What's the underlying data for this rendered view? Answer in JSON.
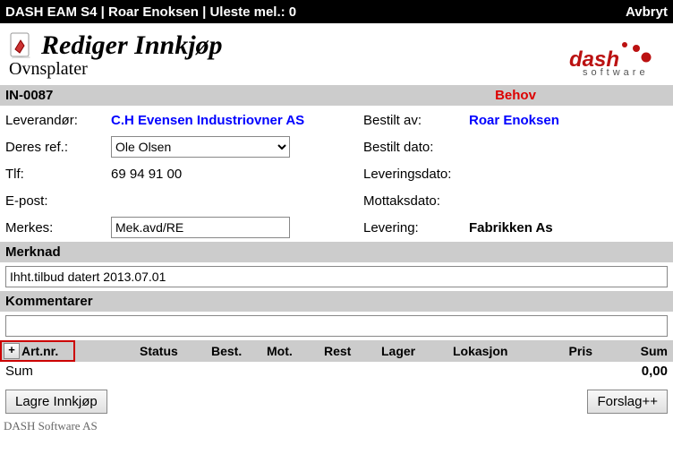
{
  "topbar": {
    "title": "DASH EAM S4 | Roar Enoksen | Uleste mel.: 0",
    "cancel": "Avbryt"
  },
  "header": {
    "title": "Rediger Innkjøp",
    "subtitle": "Ovnsplater",
    "logo_brand": "dash",
    "logo_sub": "software"
  },
  "info": {
    "id": "IN-0087",
    "status": "Behov",
    "left": {
      "supplier_label": "Leverandør:",
      "supplier_value": "C.H Evensen Industriovner AS",
      "their_ref_label": "Deres ref.:",
      "their_ref_value": "Ole Olsen",
      "phone_label": "Tlf:",
      "phone_value": "69 94 91 00",
      "email_label": "E-post:",
      "email_value": "",
      "marked_label": "Merkes:",
      "marked_value": "Mek.avd/RE"
    },
    "right": {
      "ordered_by_label": "Bestilt av:",
      "ordered_by_value": "Roar Enoksen",
      "ordered_date_label": "Bestilt dato:",
      "ordered_date_value": "",
      "delivery_date_label": "Leveringsdato:",
      "delivery_date_value": "",
      "received_date_label": "Mottaksdato:",
      "received_date_value": "",
      "delivery_label": "Levering:",
      "delivery_value": "Fabrikken As"
    }
  },
  "note": {
    "header": "Merknad",
    "value": "Ihht.tilbud datert 2013.07.01"
  },
  "comments": {
    "header": "Kommentarer",
    "value": ""
  },
  "table": {
    "add": "+",
    "col_artnr": "Art.nr.",
    "col_status": "Status",
    "col_best": "Best.",
    "col_mot": "Mot.",
    "col_rest": "Rest",
    "col_lager": "Lager",
    "col_lokasjon": "Lokasjon",
    "col_pris": "Pris",
    "col_sum": "Sum",
    "sum_label": "Sum",
    "sum_value": "0,00"
  },
  "footer": {
    "save": "Lagre Innkjøp",
    "suggest": "Forslag++",
    "company": "DASH Software AS"
  }
}
